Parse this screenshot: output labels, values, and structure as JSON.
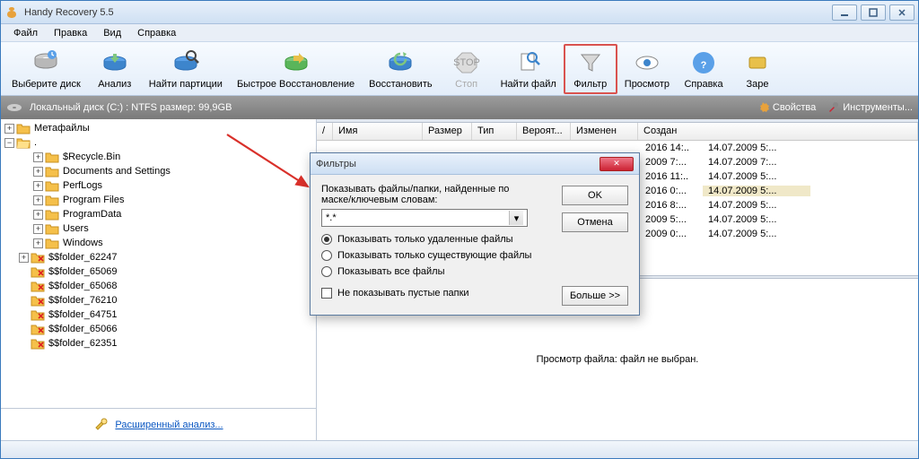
{
  "window": {
    "title": "Handy Recovery 5.5"
  },
  "menu": {
    "file": "Файл",
    "edit": "Правка",
    "view": "Вид",
    "help": "Справка"
  },
  "toolbar": {
    "select_disk": "Выберите диск",
    "analyze": "Анализ",
    "find_partitions": "Найти партиции",
    "fast_recovery": "Быстрое Восстановление",
    "recover": "Восстановить",
    "stop": "Стоп",
    "find_file": "Найти файл",
    "filter": "Фильтр",
    "preview": "Просмотр",
    "help": "Справка",
    "register": "Заре"
  },
  "pathbar": {
    "text": "Локальный диск (C:) : NTFS размер: 99,9GB",
    "properties": "Свойства",
    "tools": "Инструменты..."
  },
  "tree": {
    "meta": "Метафайлы",
    "dot": ".",
    "items": [
      "$Recycle.Bin",
      "Documents and Settings",
      "PerfLogs",
      "Program Files",
      "ProgramData",
      "Users",
      "Windows"
    ],
    "deleted": [
      "$$folder_62247",
      "$$folder_65069",
      "$$folder_65068",
      "$$folder_76210",
      "$$folder_64751",
      "$$folder_65066",
      "$$folder_62351"
    ]
  },
  "adv_link": "Расширенный анализ...",
  "list": {
    "cols": {
      "slash": "/",
      "name": "Имя",
      "size": "Размер",
      "type": "Тип",
      "prob": "Вероят...",
      "modified": "Изменен",
      "created": "Создан"
    },
    "rows": [
      {
        "m": "2016 14:..",
        "c": "14.07.2009 5:..."
      },
      {
        "m": "2009 7:...",
        "c": "14.07.2009 7:..."
      },
      {
        "m": "2016 11:..",
        "c": "14.07.2009 5:..."
      },
      {
        "m": "2016 0:...",
        "c": "14.07.2009 5:...",
        "sel": true
      },
      {
        "m": "2016 8:...",
        "c": "14.07.2009 5:..."
      },
      {
        "m": "2009 5:...",
        "c": "14.07.2009 5:..."
      },
      {
        "m": "2009 0:...",
        "c": "14.07.2009 5:..."
      }
    ]
  },
  "preview_text": "Просмотр файла: файл не выбран.",
  "dialog": {
    "title": "Фильтры",
    "desc": "Показывать файлы/папки, найденные по маске/ключевым словам:",
    "mask": "*.*",
    "opt1": "Показывать только удаленные файлы",
    "opt2": "Показывать только существующие файлы",
    "opt3": "Показывать все файлы",
    "chk": "Не показывать пустые папки",
    "ok": "OK",
    "cancel": "Отмена",
    "more": "Больше >>"
  }
}
